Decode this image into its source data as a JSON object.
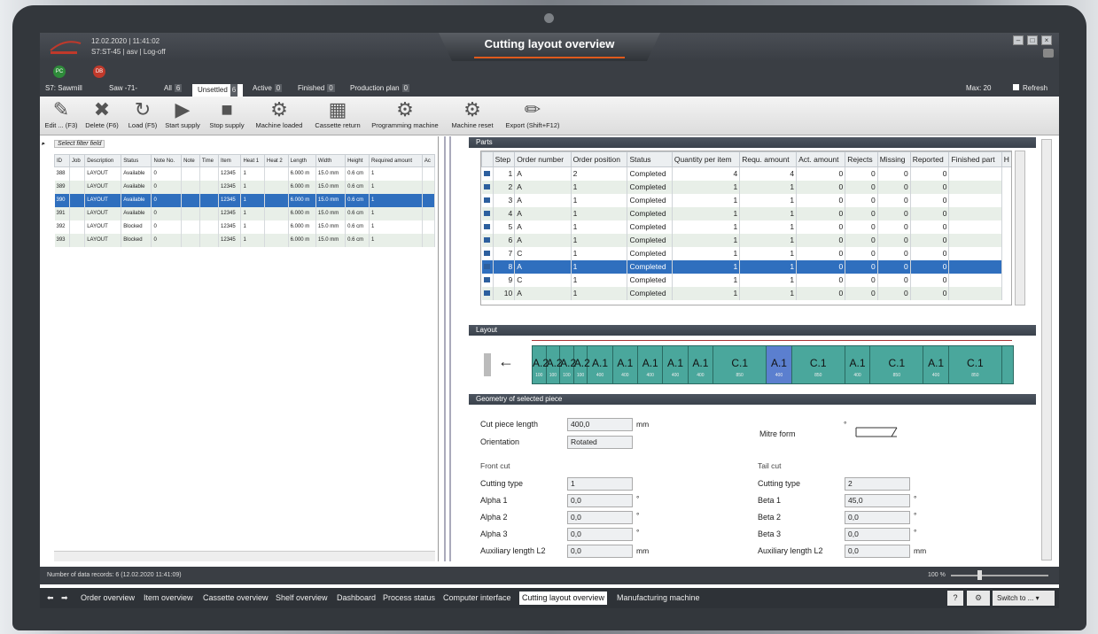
{
  "app": {
    "window_title": "Cutting layout overview",
    "datetime": "12.02.2020 | 11:41:02",
    "user_line": "S7:ST-45 | asv | Log-off",
    "status_dots": [
      {
        "label": "PC",
        "color": "#2e8b3a"
      },
      {
        "label": "DB",
        "color": "#c0392b"
      }
    ]
  },
  "tabs": {
    "machine": "S7: Sawmill",
    "saw": "Saw -71-",
    "items": [
      {
        "label": "All",
        "count": "6"
      },
      {
        "label": "Unsettled",
        "count": "6"
      },
      {
        "label": "Active",
        "count": "0"
      },
      {
        "label": "Finished",
        "count": "0"
      },
      {
        "label": "Production plan",
        "count": "0"
      }
    ],
    "max_label": "Max: 20",
    "refresh_label": "Refresh"
  },
  "toolbar": [
    {
      "label": "Edit ... (F3)",
      "icon": "edit-icon"
    },
    {
      "label": "Delete (F6)",
      "icon": "delete-icon"
    },
    {
      "label": "Load (F5)",
      "icon": "refresh-icon"
    },
    {
      "label": "Start supply",
      "icon": "play-icon"
    },
    {
      "label": "Stop supply",
      "icon": "stop-icon"
    },
    {
      "label": "Machine loaded",
      "icon": "gears-icon"
    },
    {
      "label": "Cassette return",
      "icon": "cassette-icon"
    },
    {
      "label": "Programming machine",
      "icon": "gears-arrow-icon"
    },
    {
      "label": "Machine reset",
      "icon": "gears-reset-icon"
    },
    {
      "label": "Export (Shift+F12)",
      "icon": "pencil-icon"
    }
  ],
  "left_grid": {
    "filter_placeholder": "Select filter field",
    "columns": [
      "ID",
      "Job",
      "Description",
      "Status",
      "Note No.",
      "Note",
      "Time",
      "Item",
      "Heat 1",
      "Heat 2",
      "Length",
      "Width",
      "Height",
      "Required amount",
      "Ac"
    ],
    "rows": [
      [
        "388",
        "",
        "LAYOUT",
        "Available",
        "0",
        "",
        "",
        "12345",
        "1",
        "",
        "6.000 m",
        "15.0 mm",
        "0.6 cm",
        "1",
        ""
      ],
      [
        "389",
        "",
        "LAYOUT",
        "Available",
        "0",
        "",
        "",
        "12345",
        "1",
        "",
        "6.000 m",
        "15.0 mm",
        "0.6 cm",
        "1",
        ""
      ],
      [
        "390",
        "",
        "LAYOUT",
        "Available",
        "0",
        "",
        "",
        "12345",
        "1",
        "",
        "6.000 m",
        "15.0 mm",
        "0.6 cm",
        "1",
        ""
      ],
      [
        "391",
        "",
        "LAYOUT",
        "Available",
        "0",
        "",
        "",
        "12345",
        "1",
        "",
        "6.000 m",
        "15.0 mm",
        "0.6 cm",
        "1",
        ""
      ],
      [
        "392",
        "",
        "LAYOUT",
        "Blocked",
        "0",
        "",
        "",
        "12345",
        "1",
        "",
        "6.000 m",
        "15.0 mm",
        "0.6 cm",
        "1",
        ""
      ],
      [
        "393",
        "",
        "LAYOUT",
        "Blocked",
        "0",
        "",
        "",
        "12345",
        "1",
        "",
        "6.000 m",
        "15.0 mm",
        "0.6 cm",
        "1",
        ""
      ]
    ],
    "selected_index": 2
  },
  "parts": {
    "title": "Parts",
    "columns": [
      "",
      "Step",
      "Order number",
      "Order position",
      "Status",
      "Quantity per item",
      "Requ. amount",
      "Act. amount",
      "Rejects",
      "Missing",
      "Reported",
      "Finished part",
      "H"
    ],
    "rows": [
      [
        "1",
        "A",
        "2",
        "Completed",
        "4",
        "4",
        "0",
        "0",
        "0",
        "0"
      ],
      [
        "2",
        "A",
        "1",
        "Completed",
        "1",
        "1",
        "0",
        "0",
        "0",
        "0"
      ],
      [
        "3",
        "A",
        "1",
        "Completed",
        "1",
        "1",
        "0",
        "0",
        "0",
        "0"
      ],
      [
        "4",
        "A",
        "1",
        "Completed",
        "1",
        "1",
        "0",
        "0",
        "0",
        "0"
      ],
      [
        "5",
        "A",
        "1",
        "Completed",
        "1",
        "1",
        "0",
        "0",
        "0",
        "0"
      ],
      [
        "6",
        "A",
        "1",
        "Completed",
        "1",
        "1",
        "0",
        "0",
        "0",
        "0"
      ],
      [
        "7",
        "C",
        "1",
        "Completed",
        "1",
        "1",
        "0",
        "0",
        "0",
        "0"
      ],
      [
        "8",
        "A",
        "1",
        "Completed",
        "1",
        "1",
        "0",
        "0",
        "0",
        "0"
      ],
      [
        "9",
        "C",
        "1",
        "Completed",
        "1",
        "1",
        "0",
        "0",
        "0",
        "0"
      ],
      [
        "10",
        "A",
        "1",
        "Completed",
        "1",
        "1",
        "0",
        "0",
        "0",
        "0"
      ]
    ],
    "selected_index": 7
  },
  "layout": {
    "title": "Layout",
    "segments": [
      {
        "label": "A.2",
        "value": "100"
      },
      {
        "label": "A.2",
        "value": "100"
      },
      {
        "label": "A.2",
        "value": "100"
      },
      {
        "label": "A.2",
        "value": "100"
      },
      {
        "label": "A.1",
        "value": "400"
      },
      {
        "label": "A.1",
        "value": "400"
      },
      {
        "label": "A.1",
        "value": "400"
      },
      {
        "label": "A.1",
        "value": "400"
      },
      {
        "label": "A.1",
        "value": "400"
      },
      {
        "label": "C.1",
        "value": "850"
      },
      {
        "label": "A.1",
        "value": "400"
      },
      {
        "label": "C.1",
        "value": "850"
      },
      {
        "label": "A.1",
        "value": "400"
      },
      {
        "label": "C.1",
        "value": "850"
      },
      {
        "label": "A.1",
        "value": "400"
      },
      {
        "label": "C.1",
        "value": "850"
      }
    ],
    "selected_index": 10
  },
  "geometry": {
    "title": "Geometry of selected piece",
    "cut_piece_length_label": "Cut piece length",
    "cut_piece_length": "400,0",
    "unit_mm": "mm",
    "orientation_label": "Orientation",
    "orientation": "Rotated",
    "mitre_label": "Mitre form",
    "mitre_mark": "°",
    "front_cut": {
      "title": "Front cut",
      "cutting_type_label": "Cutting type",
      "cutting_type": "1",
      "alpha1_label": "Alpha 1",
      "alpha1": "0,0",
      "alpha2_label": "Alpha 2",
      "alpha2": "0,0",
      "alpha3_label": "Alpha 3",
      "alpha3": "0,0",
      "aux_label": "Auxiliary length L2",
      "aux": "0,0"
    },
    "tail_cut": {
      "title": "Tail cut",
      "cutting_type_label": "Cutting type",
      "cutting_type": "2",
      "beta1_label": "Beta 1",
      "beta1": "45,0",
      "beta2_label": "Beta 2",
      "beta2": "0,0",
      "beta3_label": "Beta 3",
      "beta3": "0,0",
      "aux_label": "Auxiliary length L2",
      "aux": "0,0"
    },
    "degree": "°"
  },
  "footer": {
    "records": "Number of data records: 6  (12.02.2020 11:41:09)",
    "zoom": "100 %",
    "nav": [
      "Order overview",
      "Item overview",
      "Cassette overview",
      "Shelf overview",
      "Dashboard",
      "Process status",
      "Computer interface",
      "Cutting layout overview",
      "Manufacturing machine"
    ],
    "nav_active": 7,
    "help": "?",
    "switch_to": "Switch to ..."
  }
}
